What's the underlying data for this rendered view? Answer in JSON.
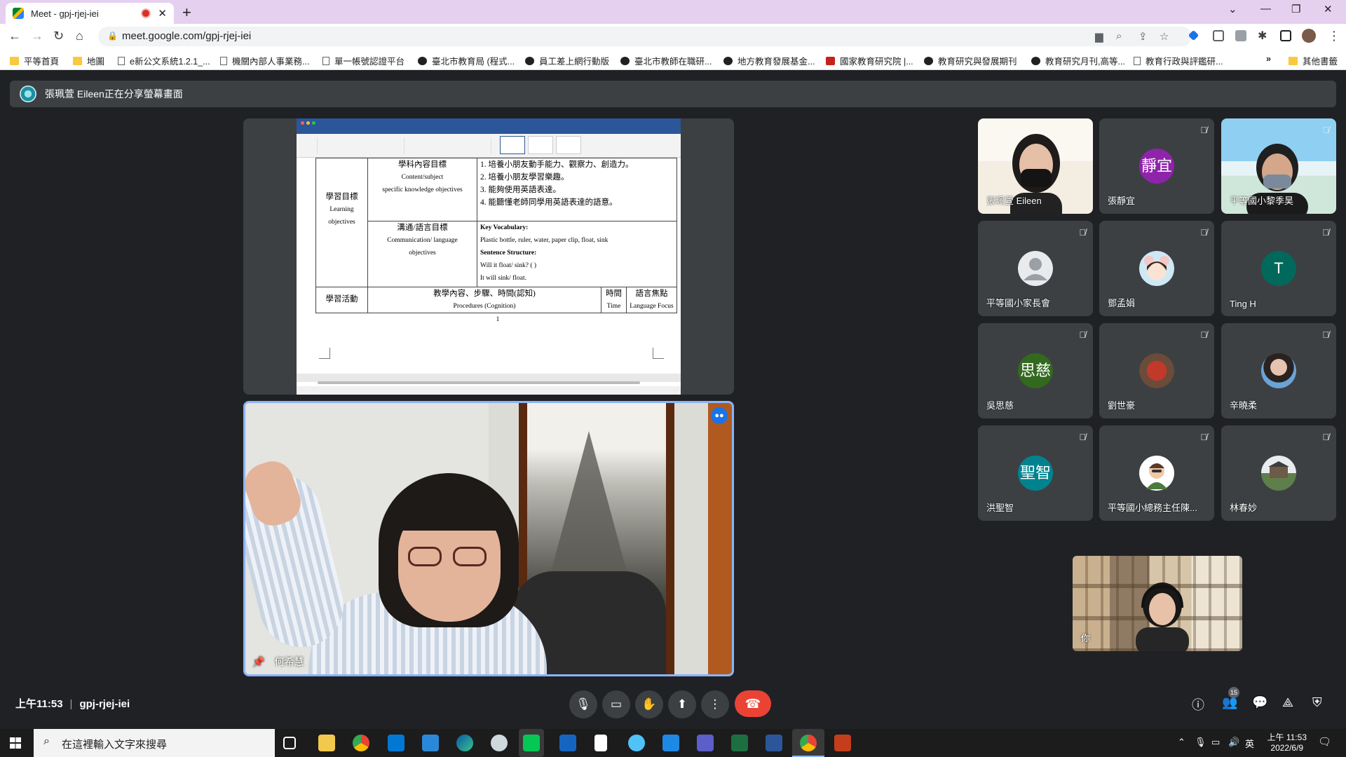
{
  "browser": {
    "tab_title": "Meet - gpj-rjej-iei",
    "url": "meet.google.com/gpj-rjej-iei",
    "bookmarks": [
      "平等首頁",
      "地圖",
      "e新公文系統1.2.1_...",
      "機關內部人事業務...",
      "單一帳號認證平台",
      "臺北市教育局 (程式...",
      "員工差上網行動版",
      "臺北市教師在職研...",
      "地方教育發展基金...",
      "國家教育研究院 |...",
      "教育研究與發展期刊",
      "教育研究月刊,高等...",
      "教育行政與評鑑研..."
    ],
    "bookmarks_more": "»",
    "other_bookmarks": "其他書籤"
  },
  "meet": {
    "present_banner": "張珮萱 Eileen正在分享螢幕畫面",
    "speaker_name": "何希慧",
    "self_label": "你",
    "time": "上午11:53",
    "meeting_code": "gpj-rjej-iei",
    "participant_count": "15",
    "participants": [
      {
        "name": "張珮萱 Eileen"
      },
      {
        "name": "張靜宜",
        "initials": "靜宜"
      },
      {
        "name": "平等國小黎季昊"
      },
      {
        "name": "平等國小家長會"
      },
      {
        "name": "鄧孟娟"
      },
      {
        "name": "Ting H",
        "initials": "T"
      },
      {
        "name": "吳思慈",
        "initials": "思慈"
      },
      {
        "name": "劉世豪"
      },
      {
        "name": "辛曉柔"
      },
      {
        "name": "洪聖智",
        "initials": "聖智"
      },
      {
        "name": "平等國小總務主任陳..."
      },
      {
        "name": "林春妙"
      }
    ]
  },
  "document": {
    "rows": {
      "objectives_header": "學習目標",
      "objectives_en": [
        "Learning",
        "objectives"
      ],
      "content_header": "學科內容目標",
      "content_en": [
        "Content/subject",
        "specific knowledge objectives"
      ],
      "content_items": [
        "1. 培養小朋友動手能力、觀察力、創造力。",
        "2. 培養小朋友學習樂趣。",
        "3. 能夠使用英語表達。",
        "4. 能聽懂老師同學用英語表達的語意。"
      ],
      "comm_header": "溝通/語言目標",
      "comm_en": [
        "Communication/ language",
        "objectives"
      ],
      "key_vocab_label": "Key Vocabulary:",
      "key_vocab": "Plastic bottle, ruler, water, paper clip, float, sink",
      "sentence_label": "Sentence Structure:",
      "sentence_1": "Will it float/ sink? (  )",
      "sentence_2": "It will sink/ float.",
      "activities_header": "學習活動",
      "procedures_zh": "教學內容、步驟、時間(認知)",
      "procedures_en": "Procedures (Cognition)",
      "time_zh": "時間",
      "time_en": "Time",
      "focus_zh": "語言焦點",
      "focus_en": "Language Focus",
      "page_number": "1"
    }
  },
  "taskbar": {
    "search_placeholder": "在這裡輸入文字來搜尋",
    "time": "上午 11:53",
    "date": "2022/6/9",
    "ime": "英"
  },
  "colors": {
    "meet_bg": "#202124",
    "tile_bg": "#3c4043",
    "active_speaker": "#8ab4f8",
    "hangup": "#ea4335",
    "avatar_purple": "#8e24aa",
    "avatar_teal": "#00695c",
    "avatar_green": "#33691e",
    "avatar_cyan": "#00838f"
  }
}
